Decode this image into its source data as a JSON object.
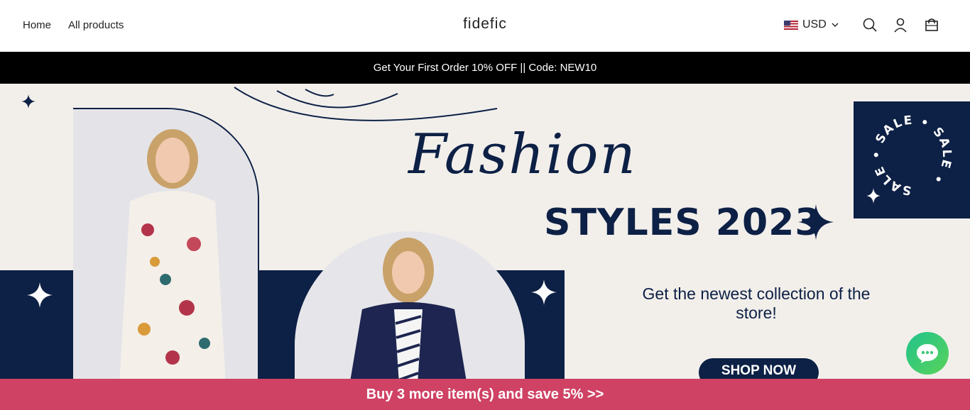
{
  "header": {
    "nav": [
      {
        "label": "Home"
      },
      {
        "label": "All products"
      }
    ],
    "logo": "fidefic",
    "currency": {
      "label": "USD",
      "flag_icon": "us-flag-icon"
    },
    "icons": [
      "search-icon",
      "account-icon",
      "cart-icon"
    ]
  },
  "announcement": {
    "text": "Get Your First Order 10% OFF || Code: NEW10"
  },
  "hero": {
    "script_title": "Fashion",
    "bold_title": "STYLES 2023",
    "subtitle": "Get the newest collection of the store!",
    "cta": "SHOP NOW",
    "sale_badge": "SALE • SALE • SALE •",
    "colors": {
      "navy": "#0d2045",
      "background": "#f2efeb"
    }
  },
  "chat": {
    "icon": "chat-icon",
    "color": "#20c38c"
  },
  "promo_bar": {
    "text": "Buy 3 more item(s) and save 5%  >>",
    "color": "#cf4264"
  }
}
